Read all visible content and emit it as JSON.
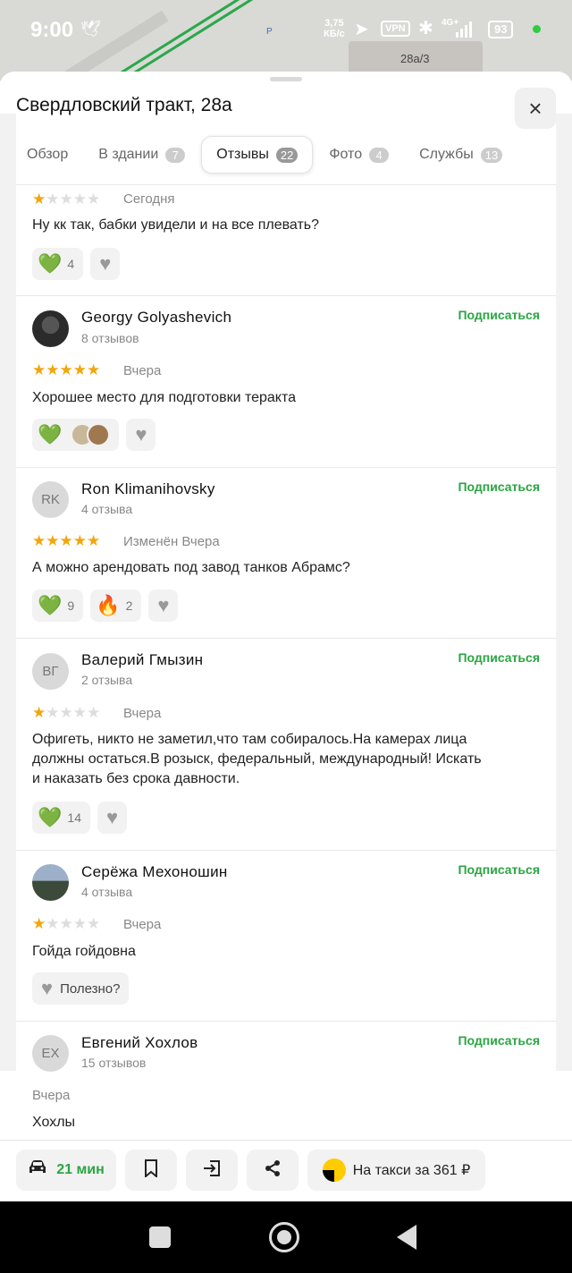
{
  "status_bar": {
    "time": "9:00",
    "speed_value": "3,75",
    "speed_unit": "КБ/с",
    "vpn": "VPN",
    "network": "4G+",
    "battery": "93"
  },
  "map": {
    "building_label": "28а/3",
    "parking_label": "P"
  },
  "sheet": {
    "title": "Свердловский тракт, 28а",
    "close_icon": "×"
  },
  "tabs": [
    {
      "label": "Обзор",
      "count": ""
    },
    {
      "label": "В здании",
      "count": "7"
    },
    {
      "label": "Отзывы",
      "count": "22",
      "active": true
    },
    {
      "label": "Фото",
      "count": "4"
    },
    {
      "label": "Службы",
      "count": "13"
    }
  ],
  "reviews": [
    {
      "rating": 1,
      "date": "Сегодня",
      "text": "Ну кк так, бабки увидели и на все плевать?",
      "reactions": {
        "heart_count": "4"
      }
    },
    {
      "name": "Georgy Golyashevich",
      "count": "8 отзывов",
      "subscribe": "Подписаться",
      "rating": 5,
      "date": "Вчера",
      "text": "Хорошее место для подготовки теракта"
    },
    {
      "name": "Ron Klimanihovsky",
      "initials": "RK",
      "count": "4 отзыва",
      "subscribe": "Подписаться",
      "rating": 5,
      "date": "Изменён Вчера",
      "text": "А можно арендовать под завод танков Абрамс?",
      "reactions": {
        "heart_count": "9",
        "fire_count": "2"
      }
    },
    {
      "name": "Валерий Гмызин",
      "initials": "ВГ",
      "count": "2 отзыва",
      "subscribe": "Подписаться",
      "rating": 1,
      "date": "Вчера",
      "text_lines": [
        "Офигеть, никто не заметил,что там собиралось.На камерах лица",
        "должны остаться.В розыск, федеральный, международный! Искать",
        "и наказать без срока давности."
      ],
      "reactions": {
        "heart_count": "14"
      }
    },
    {
      "name": "Серёжа Мехоношин",
      "count": "4 отзыва",
      "subscribe": "Подписаться",
      "rating": 1,
      "date": "Вчера",
      "text": "Гойда гойдовна",
      "useful_label": "Полезно?"
    },
    {
      "name": "Евгений Хохлов",
      "initials": "ЕХ",
      "count": "15 отзывов",
      "subscribe": "Подписаться",
      "date": "Вчера",
      "text": "Хохлы"
    }
  ],
  "bottom_bar": {
    "car_time": "21 мин",
    "taxi_label": "На такси за 361 ₽"
  },
  "icons": {
    "star": "★",
    "heart_green": "💚",
    "heart_gray": "♥",
    "fire": "🔥",
    "car": "🚘",
    "bookmark": "🔖",
    "enter": "⇥",
    "share": "⟟"
  },
  "colors": {
    "accent_green": "#2aa542",
    "star_yellow": "#f2a60c",
    "taxi_yellow": "#ffcc00"
  }
}
